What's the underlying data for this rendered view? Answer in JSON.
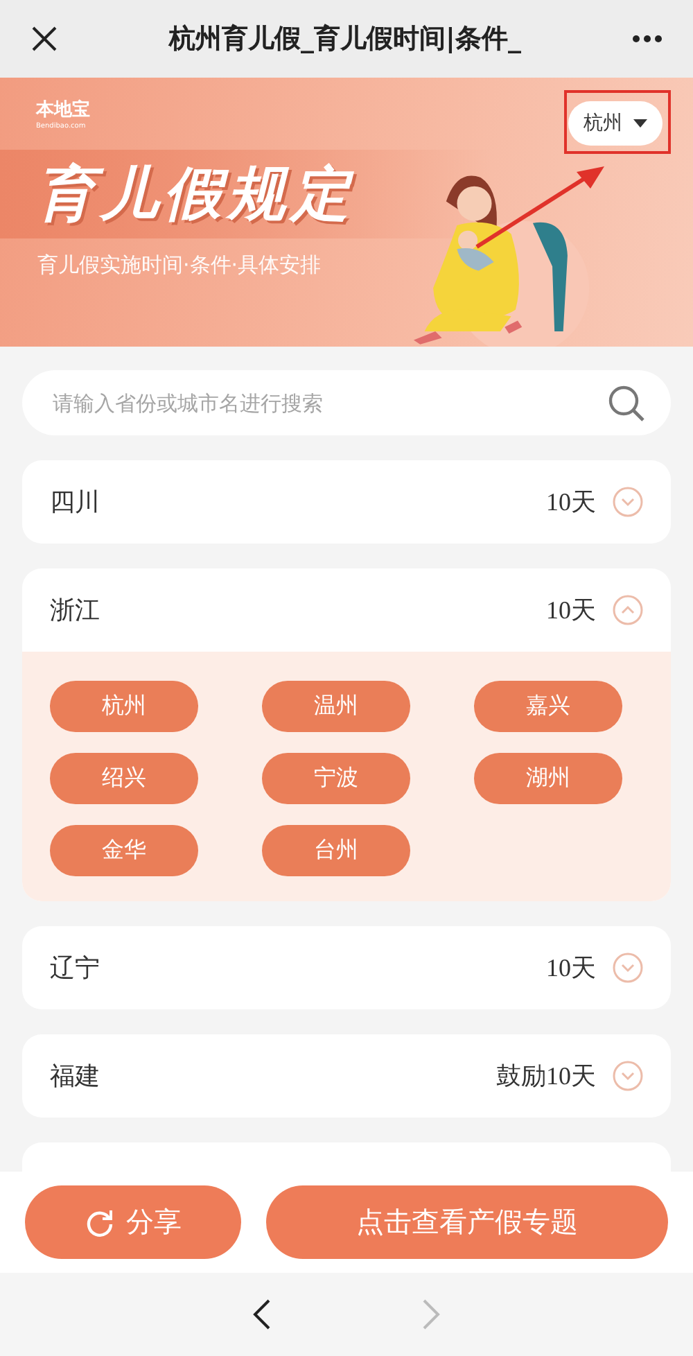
{
  "top_bar": {
    "title": "杭州育儿假_育儿假时间|条件_"
  },
  "banner": {
    "logo": "本地宝",
    "logo_sub": "Bendibao.com",
    "heading": "育儿假规定",
    "subtitle": "育儿假实施时间·条件·具体安排",
    "city": "杭州",
    "city_highlighted": true
  },
  "search": {
    "placeholder": "请输入省份或城市名进行搜索"
  },
  "provinces": [
    {
      "name": "四川",
      "days": "10天",
      "expanded": false
    },
    {
      "name": "浙江",
      "days": "10天",
      "expanded": true,
      "cities": [
        "杭州",
        "温州",
        "嘉兴",
        "绍兴",
        "宁波",
        "湖州",
        "金华",
        "台州"
      ]
    },
    {
      "name": "辽宁",
      "days": "10天",
      "expanded": false
    },
    {
      "name": "福建",
      "days": "鼓励10天",
      "expanded": false
    }
  ],
  "actions": [
    {
      "kind": "share",
      "label": "分享"
    },
    {
      "kind": "link",
      "label": "点击查看产假专题"
    }
  ],
  "nav": {
    "back_disabled": false,
    "forward_disabled": true
  }
}
